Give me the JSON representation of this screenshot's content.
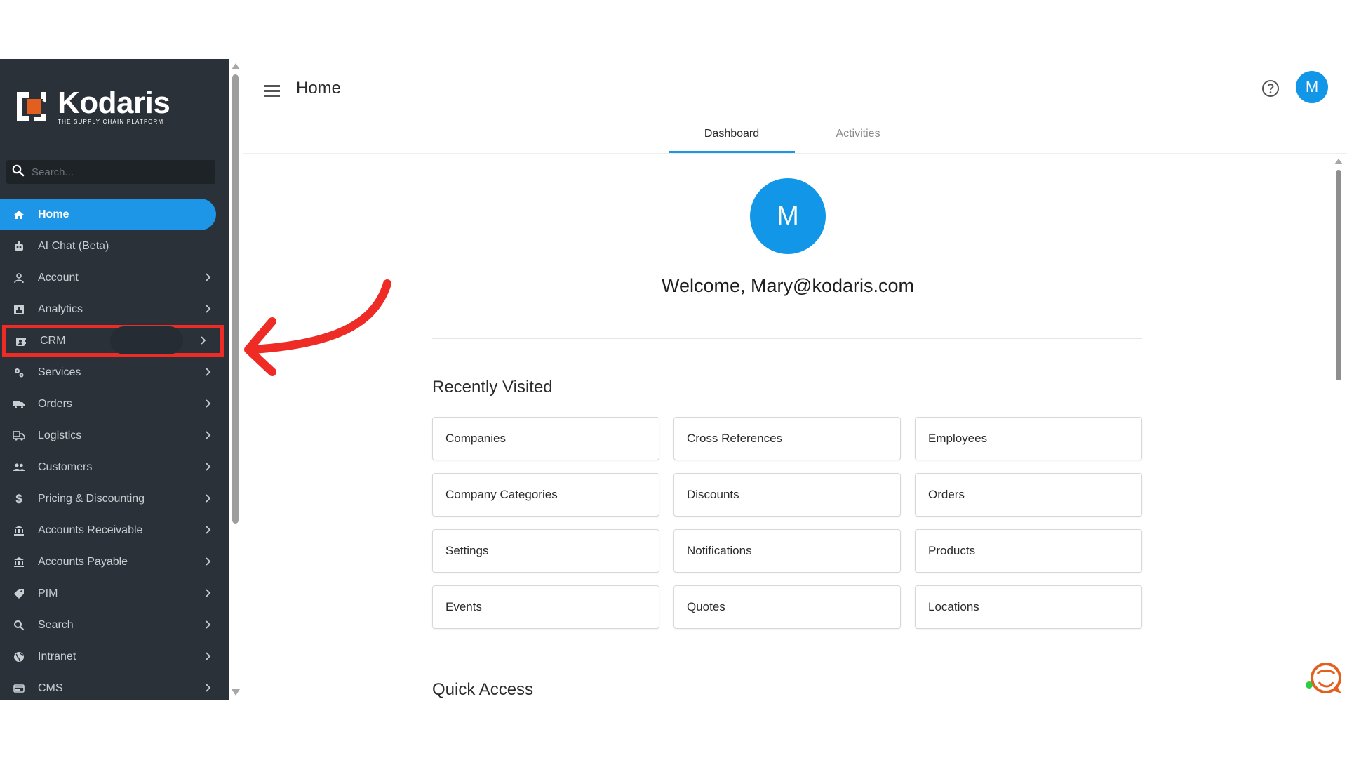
{
  "app": {
    "brand_name": "Kodaris",
    "brand_tagline": "THE SUPPLY CHAIN PLATFORM",
    "brand_color": "#e35f20"
  },
  "sidebar": {
    "search_placeholder": "Search...",
    "items": [
      {
        "label": "Home",
        "icon": "home-icon",
        "active": true,
        "has_chevron": false
      },
      {
        "label": "AI Chat (Beta)",
        "icon": "robot-icon",
        "active": false,
        "has_chevron": false
      },
      {
        "label": "Account",
        "icon": "user-icon",
        "active": false,
        "has_chevron": true
      },
      {
        "label": "Analytics",
        "icon": "analytics-icon",
        "active": false,
        "has_chevron": true
      },
      {
        "label": "CRM",
        "icon": "crm-icon",
        "active": false,
        "has_chevron": true,
        "highlighted": true
      },
      {
        "label": "Services",
        "icon": "gears-icon",
        "active": false,
        "has_chevron": true
      },
      {
        "label": "Orders",
        "icon": "truck-icon",
        "active": false,
        "has_chevron": true
      },
      {
        "label": "Logistics",
        "icon": "shipping-icon",
        "active": false,
        "has_chevron": true
      },
      {
        "label": "Customers",
        "icon": "users-icon",
        "active": false,
        "has_chevron": true
      },
      {
        "label": "Pricing & Discounting",
        "icon": "dollar-icon",
        "active": false,
        "has_chevron": true
      },
      {
        "label": "Accounts Receivable",
        "icon": "bank-icon",
        "active": false,
        "has_chevron": true
      },
      {
        "label": "Accounts Payable",
        "icon": "bank-icon",
        "active": false,
        "has_chevron": true
      },
      {
        "label": "PIM",
        "icon": "tag-icon",
        "active": false,
        "has_chevron": true
      },
      {
        "label": "Search",
        "icon": "search-icon",
        "active": false,
        "has_chevron": true
      },
      {
        "label": "Intranet",
        "icon": "globe-icon",
        "active": false,
        "has_chevron": true
      },
      {
        "label": "CMS",
        "icon": "cms-icon",
        "active": false,
        "has_chevron": true
      }
    ]
  },
  "header": {
    "title": "Home",
    "user_initial": "M"
  },
  "tabs": [
    {
      "label": "Dashboard",
      "active": true
    },
    {
      "label": "Activities",
      "active": false
    }
  ],
  "main": {
    "avatar_initial": "M",
    "welcome": "Welcome, Mary@kodaris.com",
    "recently_visited_title": "Recently Visited",
    "recently_visited": [
      "Companies",
      "Cross References",
      "Employees",
      "Company Categories",
      "Discounts",
      "Orders",
      "Settings",
      "Notifications",
      "Products",
      "Events",
      "Quotes",
      "Locations"
    ],
    "quick_access_title": "Quick Access"
  },
  "colors": {
    "sidebar_bg": "#2b3138",
    "accent": "#1e96e8",
    "highlight": "#ee2b24"
  }
}
